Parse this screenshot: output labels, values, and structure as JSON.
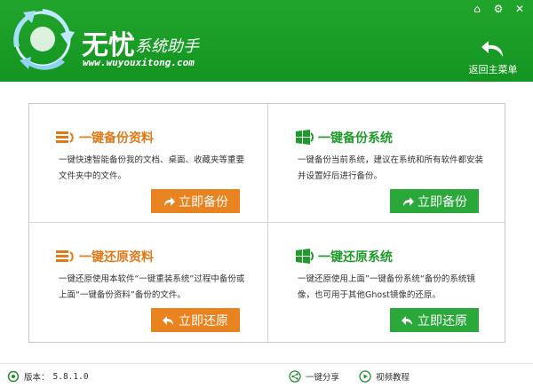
{
  "header": {
    "title": "无忧",
    "subtitle": "系统助手",
    "url": "www.wuyouxitong.com",
    "back_main_label": "返回主菜单"
  },
  "icons": {
    "top": [
      "home-icon",
      "gear-icon",
      "close-icon"
    ]
  },
  "cards": [
    {
      "title": "一键备份资料",
      "desc": "一键快速智能备份我的文档、桌面、收藏夹等重要文件夹中的文件。",
      "button": "立即备份",
      "color": "#e8831f"
    },
    {
      "title": "一键备份系统",
      "desc": "一键备份当前系统，建议在系统和所有软件都安装并设置好后进行备份。",
      "button": "立即备份",
      "color": "#2aa83a"
    },
    {
      "title": "一键还原资料",
      "desc": "一键还原使用本软件“一键重装系统”过程中备份或上面“一键备份资料”备份的文件。",
      "button": "立即还原",
      "color": "#e8831f"
    },
    {
      "title": "一键还原系统",
      "desc": "一键还原使用上面”一键备份系统“备份的系统镜像，也可用于其他Ghost镜像的还原。",
      "button": "立即还原",
      "color": "#2aa83a"
    }
  ],
  "footer": {
    "version_label": "版本：",
    "version_value": "5.8.1.0",
    "share_label": "一键分享",
    "tutorial_label": "视频教程"
  },
  "colors": {
    "header_green": "#1c9e28",
    "orange": "#e8831f",
    "green": "#2aa83a"
  }
}
